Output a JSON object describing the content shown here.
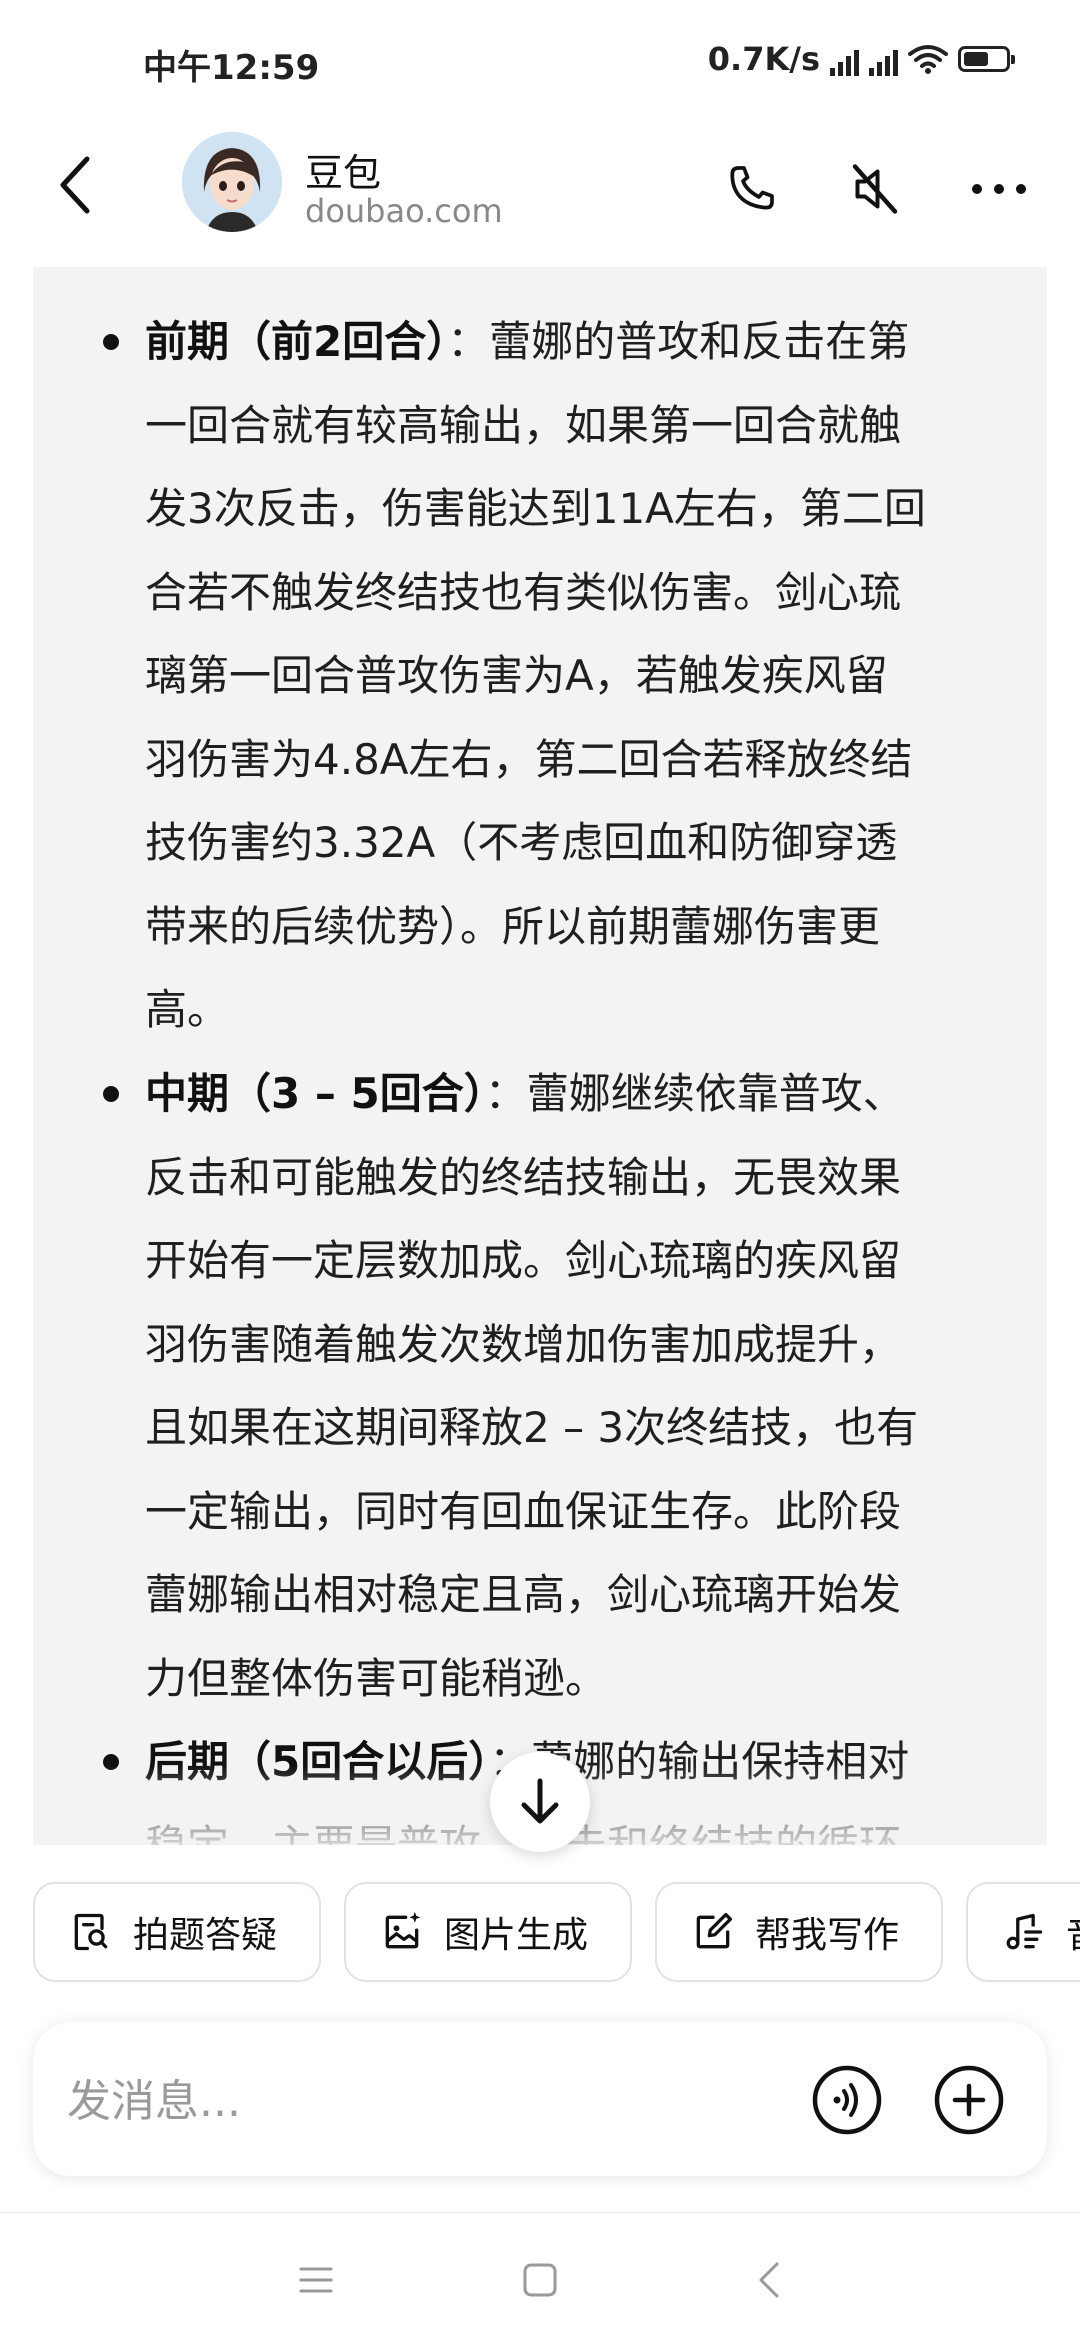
{
  "status_bar": {
    "time": "中午12:59",
    "speed": "0.7K/s",
    "battery_level": 0.6
  },
  "header": {
    "name": "豆包",
    "domain": "doubao.com"
  },
  "message": {
    "items": [
      {
        "title": "前期（前2回合）",
        "sep": "：",
        "lines": [
          "蕾娜的普攻和反击在第",
          "一回合就有较高输出，如果第一回合就触",
          "发3次反击，伤害能达到11A左右，第二回",
          "合若不触发终结技也有类似伤害。剑心琉",
          "璃第一回合普攻伤害为A，若触发疾风留",
          "羽伤害为4.8A左右，第二回合若释放终结",
          "技伤害约3.32A（不考虑回血和防御穿透",
          "带来的后续优势）。所以前期蕾娜伤害更",
          "高。"
        ]
      },
      {
        "title": "中期（3 – 5回合）",
        "sep": "：",
        "lines": [
          "蕾娜继续依靠普攻、",
          "反击和可能触发的终结技输出，无畏效果",
          "开始有一定层数加成。剑心琉璃的疾风留",
          "羽伤害随着触发次数增加伤害加成提升，",
          "且如果在这期间释放2 – 3次终结技，也有",
          "一定输出，同时有回血保证生存。此阶段",
          "蕾娜输出相对稳定且高，剑心琉璃开始发",
          "力但整体伤害可能稍逊。"
        ]
      },
      {
        "title": "后期（5回合以后）",
        "sep": "：",
        "lines": [
          "蕾娜的输出保持相对",
          "稳定，主要是普攻、反击和终结技的循环"
        ]
      }
    ]
  },
  "shortcuts": [
    {
      "label": "拍题答疑",
      "icon": "photo-question-icon"
    },
    {
      "label": "图片生成",
      "icon": "image-sparkle-icon"
    },
    {
      "label": "帮我写作",
      "icon": "edit-icon"
    },
    {
      "label": "音乐生成",
      "icon": "music-icon"
    }
  ],
  "input": {
    "placeholder": "发消息..."
  }
}
